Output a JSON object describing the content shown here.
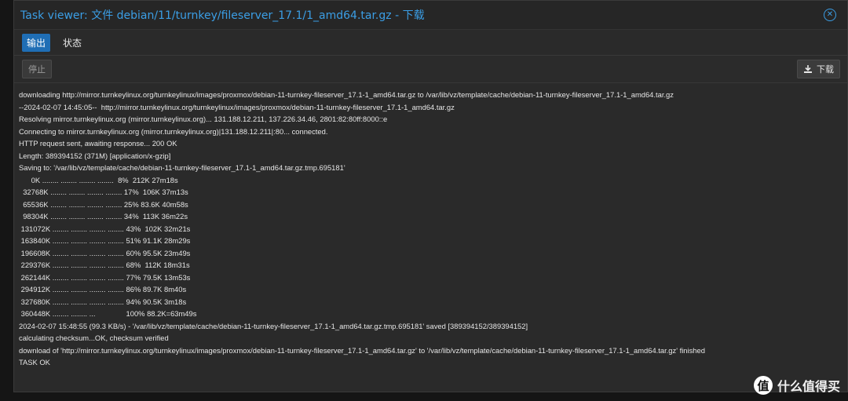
{
  "window": {
    "title": "Task viewer: 文件 debian/11/turnkey/fileserver_17.1/1_amd64.tar.gz - 下载"
  },
  "tabs": [
    {
      "label": "输出",
      "active": true
    },
    {
      "label": "状态",
      "active": false
    }
  ],
  "toolbar": {
    "stop_label": "停止",
    "download_label": "下载"
  },
  "log_lines": [
    "downloading http://mirror.turnkeylinux.org/turnkeylinux/images/proxmox/debian-11-turnkey-fileserver_17.1-1_amd64.tar.gz to /var/lib/vz/template/cache/debian-11-turnkey-fileserver_17.1-1_amd64.tar.gz",
    "--2024-02-07 14:45:05--  http://mirror.turnkeylinux.org/turnkeylinux/images/proxmox/debian-11-turnkey-fileserver_17.1-1_amd64.tar.gz",
    "Resolving mirror.turnkeylinux.org (mirror.turnkeylinux.org)... 131.188.12.211, 137.226.34.46, 2801:82:80ff:8000::e",
    "Connecting to mirror.turnkeylinux.org (mirror.turnkeylinux.org)|131.188.12.211|:80... connected.",
    "HTTP request sent, awaiting response... 200 OK",
    "Length: 389394152 (371M) [application/x-gzip]",
    "Saving to: '/var/lib/vz/template/cache/debian-11-turnkey-fileserver_17.1-1_amd64.tar.gz.tmp.695181'",
    "      0K ........ ........ ........ ........  8%  212K 27m18s",
    "  32768K ........ ........ ........ ........ 17%  106K 37m13s",
    "  65536K ........ ........ ........ ........ 25% 83.6K 40m58s",
    "  98304K ........ ........ ........ ........ 34%  113K 36m22s",
    " 131072K ........ ........ ........ ........ 43%  102K 32m21s",
    " 163840K ........ ........ ........ ........ 51% 91.1K 28m29s",
    " 196608K ........ ........ ........ ........ 60% 95.5K 23m49s",
    " 229376K ........ ........ ........ ........ 68%  112K 18m31s",
    " 262144K ........ ........ ........ ........ 77% 79.5K 13m53s",
    " 294912K ........ ........ ........ ........ 86% 89.7K 8m40s",
    " 327680K ........ ........ ........ ........ 94% 90.5K 3m18s",
    " 360448K ........ ........ ...               100% 88.2K=63m49s",
    "2024-02-07 15:48:55 (99.3 KB/s) - '/var/lib/vz/template/cache/debian-11-turnkey-fileserver_17.1-1_amd64.tar.gz.tmp.695181' saved [389394152/389394152]",
    "calculating checksum...OK, checksum verified",
    "download of 'http://mirror.turnkeylinux.org/turnkeylinux/images/proxmox/debian-11-turnkey-fileserver_17.1-1_amd64.tar.gz' to '/var/lib/vz/template/cache/debian-11-turnkey-fileserver_17.1-1_amd64.tar.gz' finished",
    "TASK OK"
  ],
  "watermark": {
    "logo_char": "值",
    "text": "什么值得买"
  },
  "colors": {
    "accent": "#3b9ee5",
    "tab_active": "#1f6eb5",
    "log_text": "#e6e6e6",
    "window_bg": "#2a2a2a"
  }
}
